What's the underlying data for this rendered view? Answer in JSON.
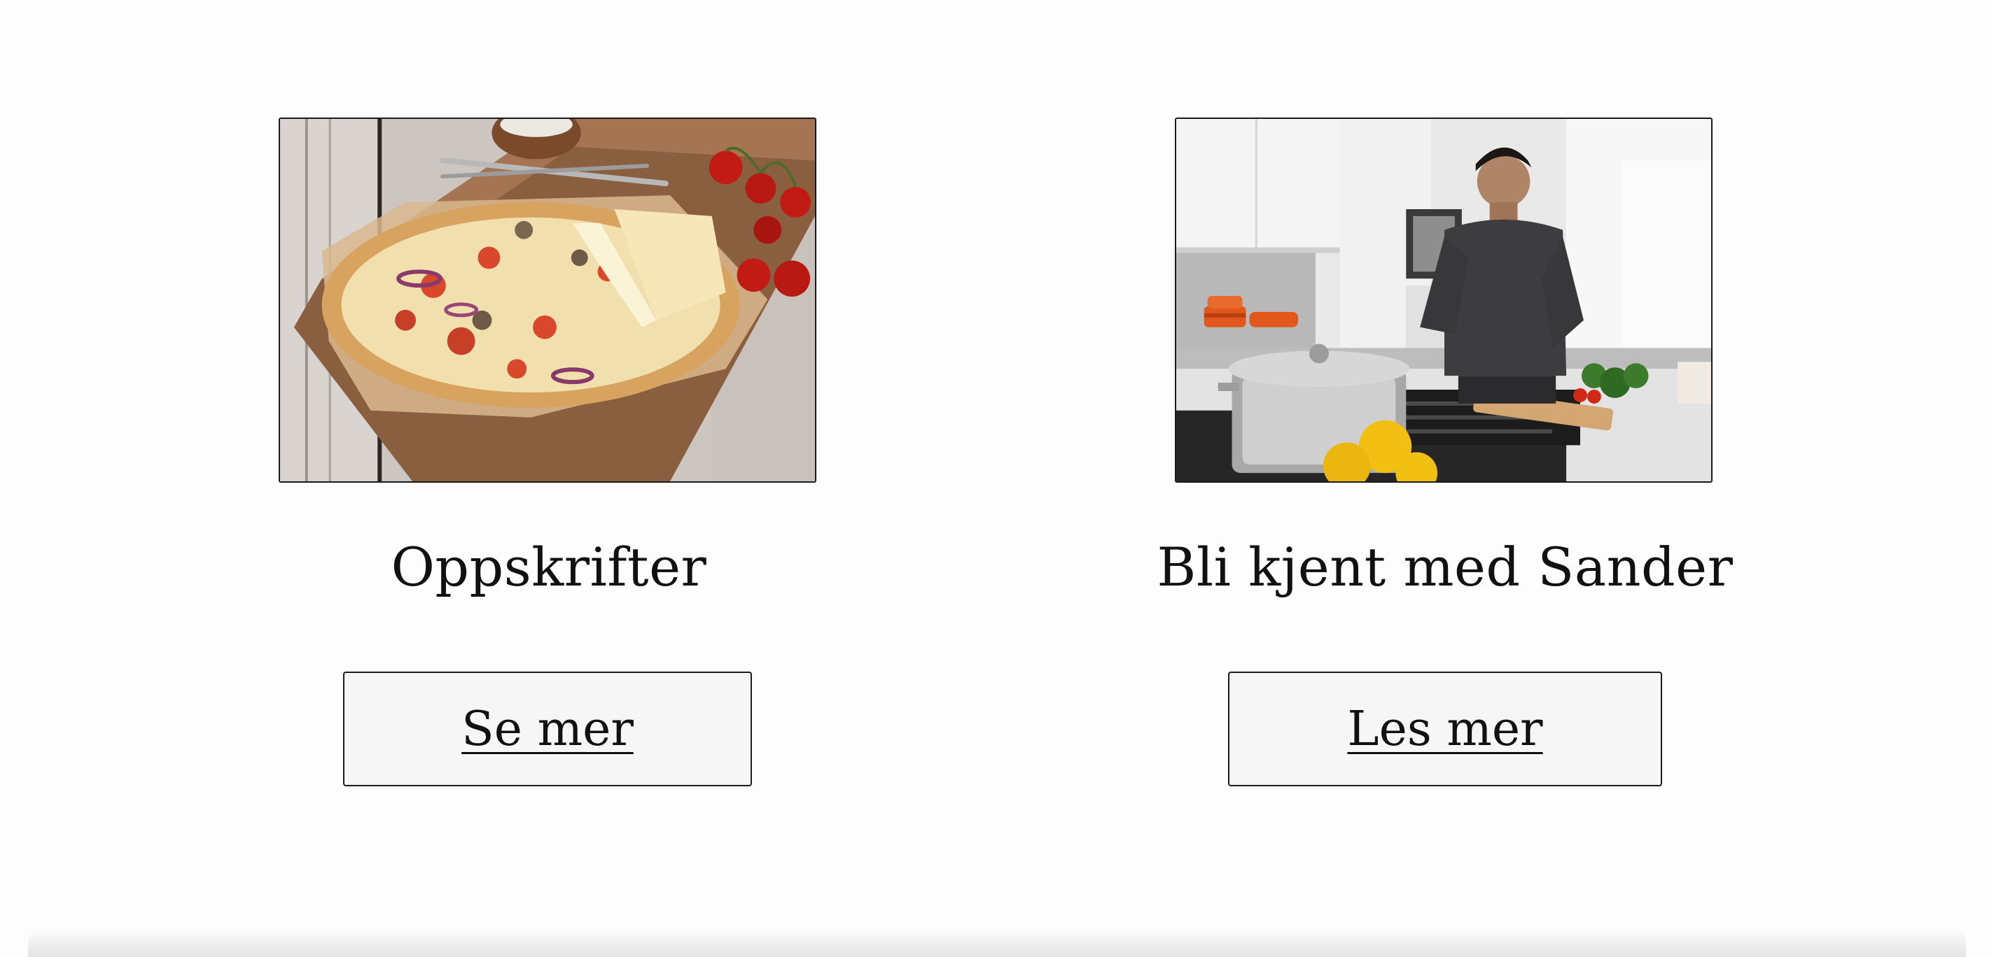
{
  "cards": [
    {
      "title": "Oppskrifter",
      "button_label": "Se mer",
      "image_subject": "pizza-photo"
    },
    {
      "title": "Bli kjent med Sander",
      "button_label": "Les mer",
      "image_subject": "kitchen-chef-photo"
    }
  ]
}
